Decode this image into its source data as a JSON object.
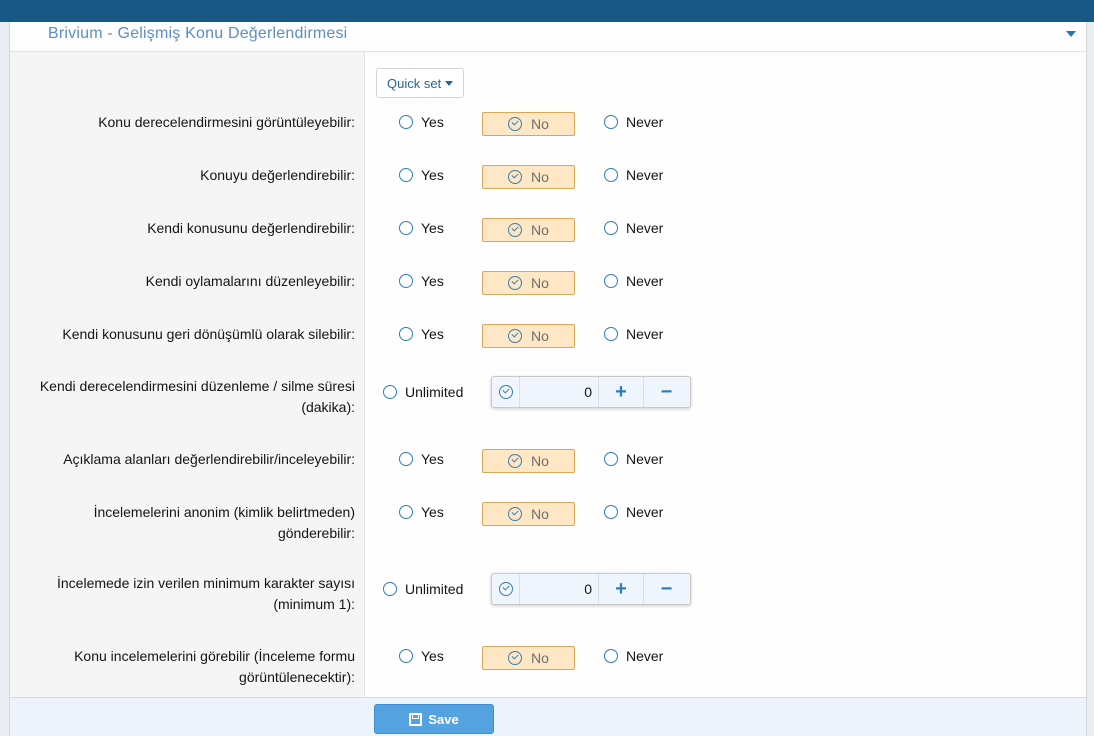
{
  "header": {
    "title": "Brivium - Gelişmiş Konu Değerlendirmesi"
  },
  "quickset": {
    "label": "Quick set"
  },
  "options": {
    "yes": "Yes",
    "no": "No",
    "never": "Never",
    "unlimited": "Unlimited"
  },
  "rows": {
    "r0": {
      "label": "Konu derecelendirmesini görüntüleyebilir:"
    },
    "r1": {
      "label": "Konuyu değerlendirebilir:"
    },
    "r2": {
      "label": "Kendi konusunu değerlendirebilir:"
    },
    "r3": {
      "label": "Kendi oylamalarını düzenleyebilir:"
    },
    "r4": {
      "label": "Kendi konusunu geri dönüşümlü olarak silebilir:"
    },
    "r5": {
      "label_1": "Kendi derecelendirmesini düzenleme / silme süresi",
      "label_2": "(dakika):",
      "value": "0"
    },
    "r6": {
      "label": "Açıklama alanları değerlendirebilir/inceleyebilir:"
    },
    "r7": {
      "label_1": "İncelemelerini anonim (kimlik belirtmeden)",
      "label_2": "gönderebilir:"
    },
    "r8": {
      "label_1": "İncelemede izin verilen minimum karakter sayısı",
      "label_2": "(minimum 1):",
      "value": "0"
    },
    "r9": {
      "label_1": "Konu incelemelerini görebilir (İnceleme formu",
      "label_2": "görüntülenecektir):"
    }
  },
  "footer": {
    "save_label": "Save"
  }
}
